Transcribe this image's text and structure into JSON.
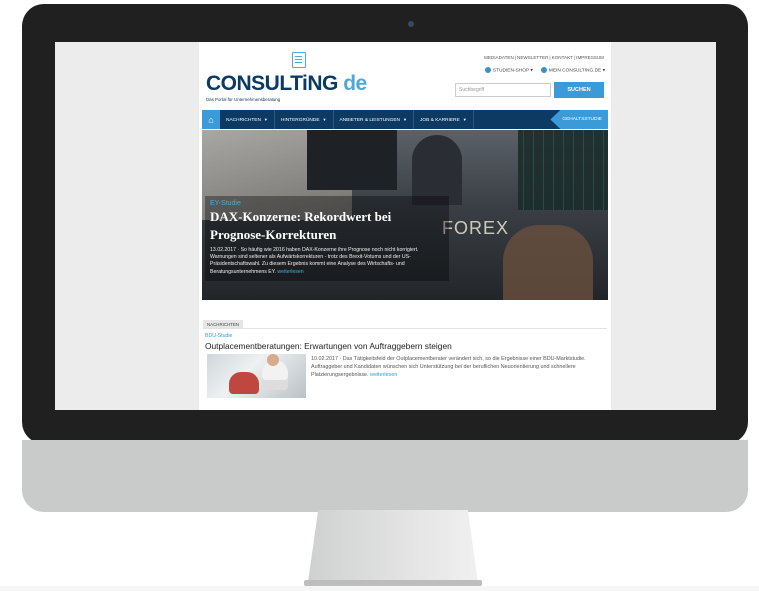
{
  "header": {
    "logo_text": "CONSULTiNG",
    "logo_domain": "de",
    "logo_tagline": "Das Portal für Unternehmensberatung",
    "top_links": [
      "MEDIADATEN",
      "NEWSLETTER",
      "KONTAKT",
      "IMPRESSUM"
    ],
    "studien_shop": "STUDIEN-SHOP",
    "mein_consulting": "MEIN CONSULTING.DE",
    "search_placeholder": "Suchbegriff",
    "search_button": "SUCHEN"
  },
  "nav": {
    "items": [
      "NACHRICHTEN",
      "HINTERGRÜNDE",
      "ANBIETER & LEISTUNGEN",
      "JOB & KARRIERE"
    ],
    "highlight": "GEHALTSSTUDIE"
  },
  "hero": {
    "kicker": "EY-Studie",
    "title": "DAX-Konzerne: Rekordwert bei Prognose-Korrekturen",
    "text": "13.02.2017 · So häufig wie 2016 haben DAX-Konzerne ihre Prognose noch nicht korrigiert. Warnungen sind seltener als Aufwärtskorrekturen - trotz des Brexit-Votums und der US-Präsidentschaftswahl. Zu diesem Ergebnis kommt eine Analyse des Wirtschafts- und Beratungsunternehmens EY.",
    "more": "weiterlesen",
    "image_text": "FOREX"
  },
  "article": {
    "section": "NACHRICHTEN",
    "kicker": "BDU-Studie",
    "title": "Outplacementberatungen: Erwartungen von Auftraggebern steigen",
    "text": "10.02.2017 · Das Tätigkeitsfeld der Outplacementberater verändert sich, so die Ergebnisse einer BDU-Marktstudie. Auftraggeber und Kandidaten wünschen sich Unterstützung bei der beruflichen Neuorientierung und schnellere Platzierungsergebnisse.",
    "more": "weiterlesen"
  },
  "colors": {
    "nav_bg": "#0d3a62",
    "accent": "#3b9ad8",
    "logo": "#0b3a66"
  }
}
